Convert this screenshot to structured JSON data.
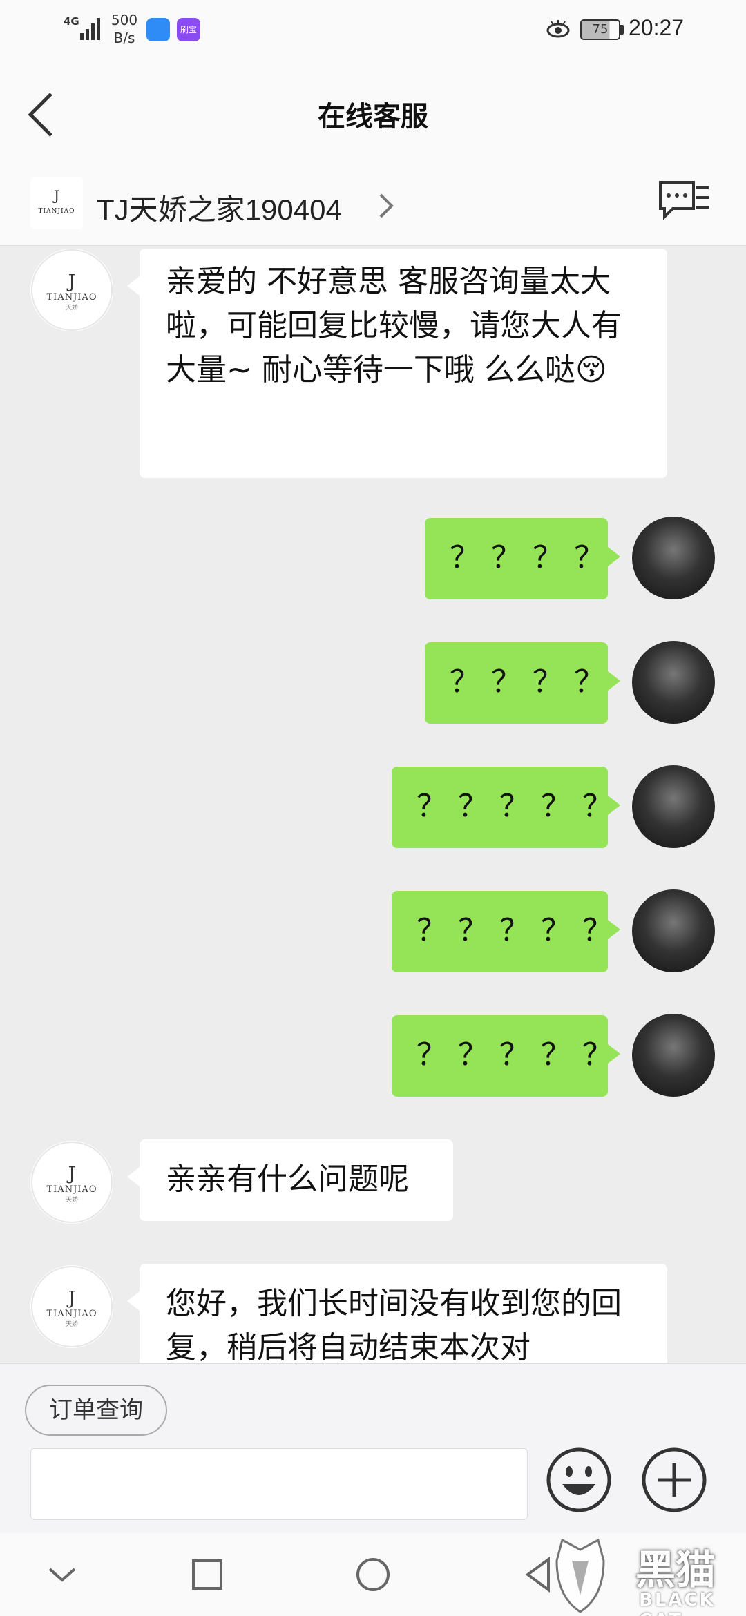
{
  "status_bar": {
    "network": "4G",
    "speed_value": "500",
    "speed_unit": "B/s",
    "app_badge": "刷宝",
    "battery": "75",
    "time": "20:27"
  },
  "header": {
    "title": "在线客服"
  },
  "shop": {
    "name": "TJ天娇之家190404",
    "logo_text": "TIANJIAO"
  },
  "avatar_shop_text": "TIANJIAO",
  "avatar_shop_sub": "天娇",
  "messages": [
    {
      "side": "in",
      "text": "亲爱的 不好意思 客服咨询量太大啦，可能回复比较慢，请您大人有大量~ 耐心等待一下哦 么么哒😚"
    },
    {
      "side": "out",
      "text": "？？？？"
    },
    {
      "side": "out",
      "text": "？？？？"
    },
    {
      "side": "out",
      "text": "？？？？？"
    },
    {
      "side": "out",
      "text": "？？？？？"
    },
    {
      "side": "out",
      "text": "？？？？？"
    },
    {
      "side": "in",
      "text": "亲亲有什么问题呢"
    },
    {
      "side": "in",
      "text": "您好，我们长时间没有收到您的回复，稍后将自动结束本次对"
    }
  ],
  "input_area": {
    "quick_reply": "订单查询",
    "input_value": ""
  },
  "watermark": {
    "brand": "黑猫",
    "brand_en": "BLACK CAT"
  },
  "colors": {
    "bubble_out": "#95e356",
    "bubble_in": "#ffffff",
    "chat_bg": "#ededed"
  }
}
